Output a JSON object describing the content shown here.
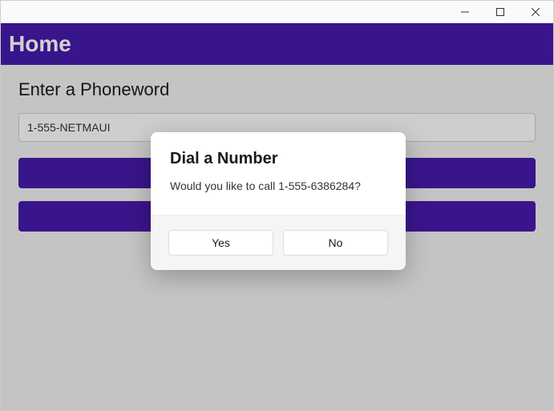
{
  "header": {
    "title": "Home"
  },
  "form": {
    "label": "Enter a Phoneword",
    "phoneword_value": "1-555-NETMAUI"
  },
  "dialog": {
    "title": "Dial a Number",
    "message": "Would you like to call 1-555-6386284?",
    "yes_label": "Yes",
    "no_label": "No"
  }
}
